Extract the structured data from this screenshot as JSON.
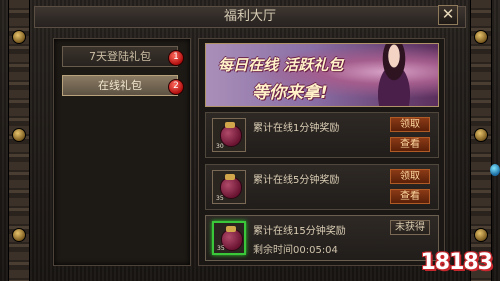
{
  "window": {
    "title": "福利大厅",
    "close_label": "✕"
  },
  "tabs": [
    {
      "label": "7天登陆礼包",
      "badge": "1",
      "selected": false
    },
    {
      "label": "在线礼包",
      "badge": "2",
      "selected": true
    }
  ],
  "banner": {
    "line1": "每日在线 活跃礼包",
    "line2": "等你来拿!"
  },
  "rewards": [
    {
      "title": "累计在线1分钟奖励",
      "item_count": "30",
      "primary": "领取",
      "secondary": "查看"
    },
    {
      "title": "累计在线5分钟奖励",
      "item_count": "35",
      "primary": "领取",
      "secondary": "查看"
    },
    {
      "title": "累计在线15分钟奖励",
      "countdown": "剩余时间00:05:04",
      "item_count": "35",
      "primary": "未获得"
    }
  ],
  "watermark": "18183"
}
